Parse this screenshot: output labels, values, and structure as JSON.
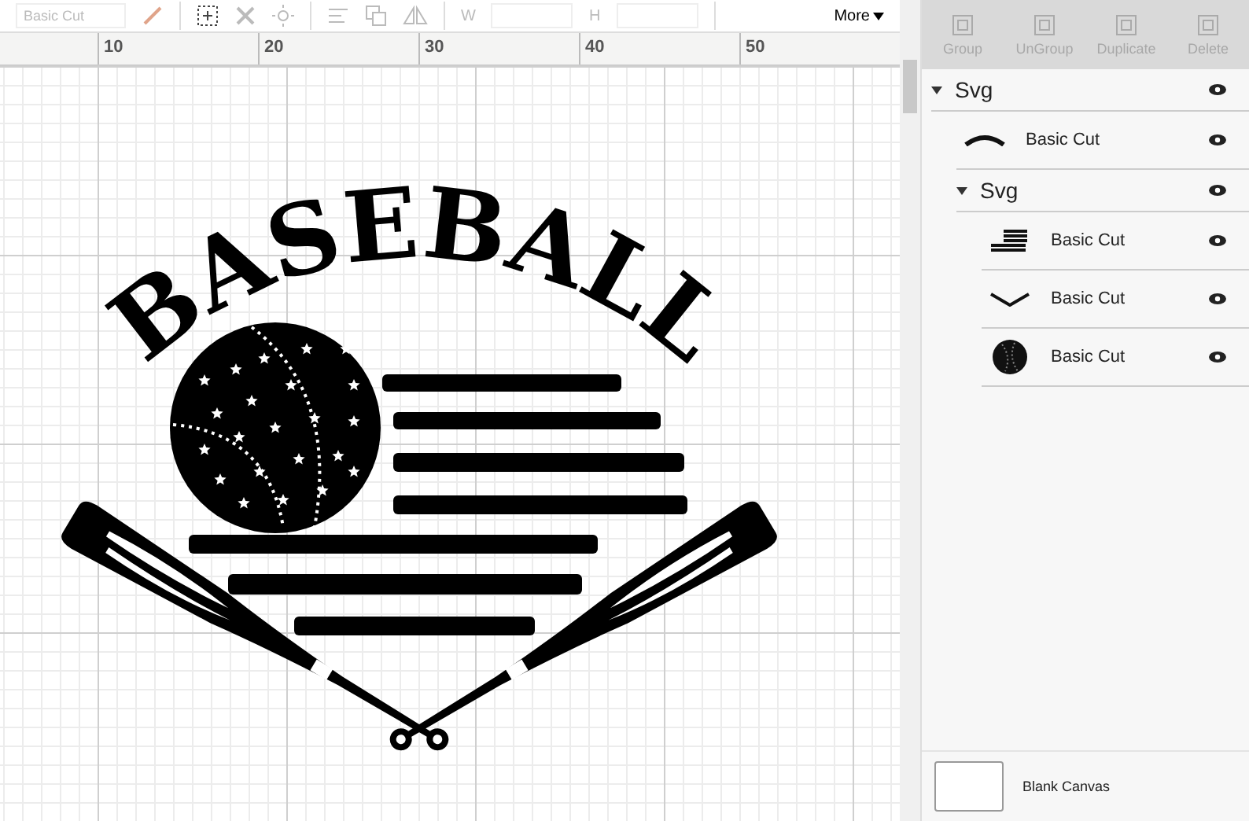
{
  "toolbar": {
    "linetype": "Basic Cut",
    "width_label": "W",
    "height_label": "H",
    "more": "More"
  },
  "ruler": [
    "10",
    "20",
    "30",
    "40",
    "50"
  ],
  "design": {
    "title": "BASEBALL"
  },
  "actions": [
    {
      "label": "Group",
      "disabled": true
    },
    {
      "label": "UnGroup",
      "disabled": true
    },
    {
      "label": "Duplicate",
      "disabled": true
    },
    {
      "label": "Delete",
      "disabled": true
    }
  ],
  "layers": [
    {
      "kind": "group",
      "name": "Svg",
      "expanded": true,
      "visible": true,
      "children": [
        {
          "kind": "item",
          "name": "Basic Cut",
          "visible": true
        },
        {
          "kind": "group",
          "name": "Svg",
          "expanded": true,
          "visible": true,
          "children": [
            {
              "kind": "item",
              "name": "Basic Cut",
              "visible": true
            },
            {
              "kind": "item",
              "name": "Basic Cut",
              "visible": true
            },
            {
              "kind": "item",
              "name": "Basic Cut",
              "visible": true
            }
          ]
        }
      ]
    }
  ],
  "canvas": {
    "label": "Blank Canvas"
  }
}
